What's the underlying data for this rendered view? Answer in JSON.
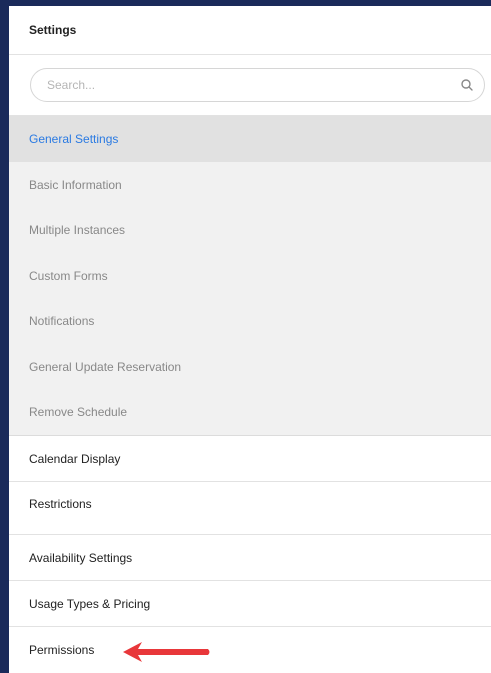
{
  "header": {
    "title": "Settings"
  },
  "search": {
    "placeholder": "Search..."
  },
  "group": {
    "title": "General Settings"
  },
  "sub_items": [
    {
      "label": "Basic Information"
    },
    {
      "label": "Multiple Instances"
    },
    {
      "label": "Custom Forms"
    },
    {
      "label": "Notifications"
    },
    {
      "label": "General Update Reservation"
    },
    {
      "label": "Remove Schedule"
    }
  ],
  "nav_items": [
    {
      "label": "Calendar Display"
    },
    {
      "label": "Restrictions"
    },
    {
      "label": "Availability Settings"
    },
    {
      "label": "Usage Types & Pricing"
    },
    {
      "label": "Permissions"
    }
  ],
  "colors": {
    "accent": "#2a7ae2",
    "arrow": "#e8373a",
    "frame": "#1a2a5a"
  }
}
